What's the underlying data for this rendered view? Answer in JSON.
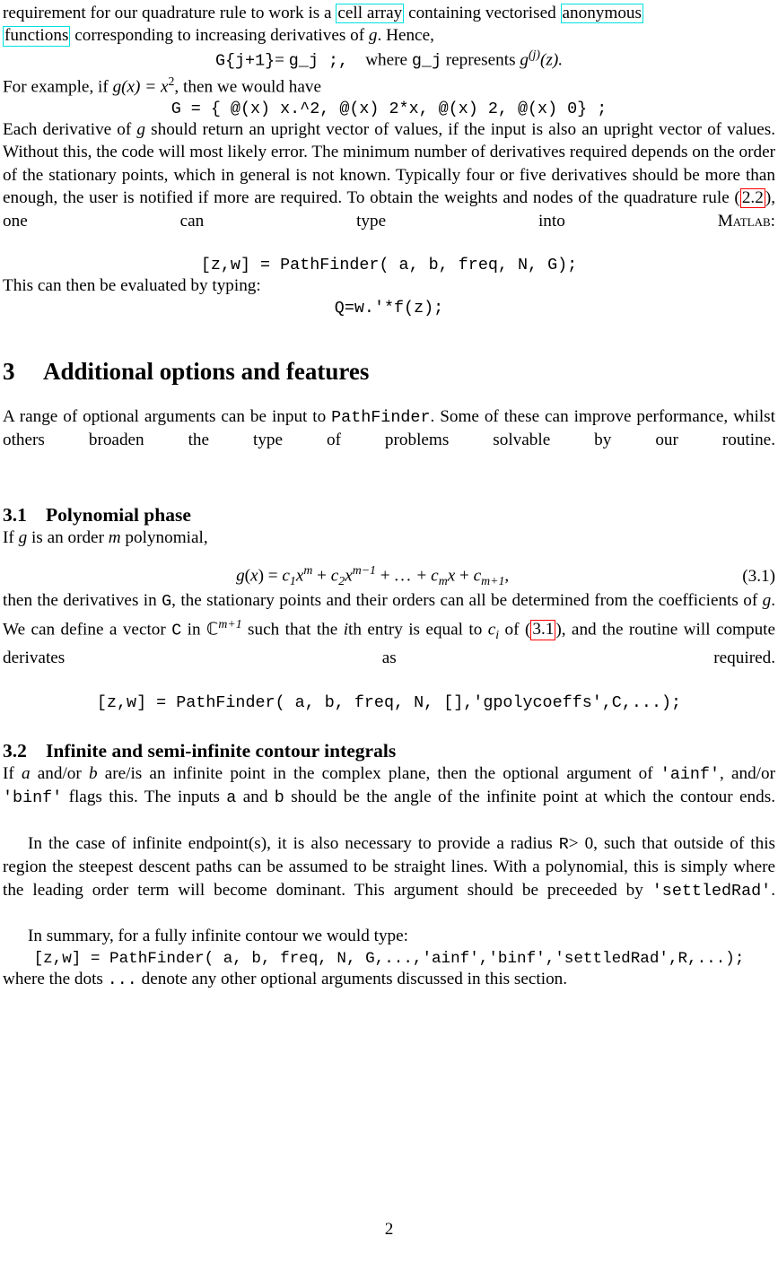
{
  "document": {
    "page_number": "2",
    "paragraphs": {
      "p1_a": "requirement for our quadrature rule to work is a ",
      "p1_link1": "cell array",
      "p1_b": " containing vectorised ",
      "p1_link2": "anonymous",
      "p1_link2b": "functions",
      "p1_c": " corresponding to increasing derivatives of ",
      "p1_g": "g",
      "p1_d": ". Hence,",
      "eq1_code1": "G{j+1}",
      "eq1_eq": "= ",
      "eq1_code2": "g_j",
      "eq1_semi": " ;,",
      "eq1_where": "where ",
      "eq1_code3": "g_j",
      "eq1_represents": " represents ",
      "eq1_gj": "g",
      "eq1_gj_sup": "(j)",
      "eq1_z": "(z).",
      "p2_a": "For example, if ",
      "p2_gx": "g(x) = x",
      "p2_sup": "2",
      "p2_b": ", then we would have",
      "eq2": "G = { @(x) x.^2, @(x) 2*x, @(x) 2, @(x) 0} ;",
      "p3_a": "Each derivative of ",
      "p3_g": "g",
      "p3_b": " should return an upright vector of values, if the input is also an upright vector of values. Without this, the code will most likely error. The minimum number of derivatives required depends on the order of the stationary points, which in general is not known. Typically four or five derivatives should be more than enough, the user is notified if more are required. To obtain the weights and nodes of the quadrature rule (",
      "p3_ref": "2.2",
      "p3_c": "), one can type into ",
      "p3_matlab": "Matlab",
      "p3_d": ":",
      "eq3": "[z,w] = PathFinder( a, b, freq, N, G);",
      "p4": "This can then be evaluated by typing:",
      "eq4": "Q=w.'*f(z);",
      "section3_num": "3",
      "section3_title": "Additional options and features",
      "p5_a": "A range of optional arguments can be input to ",
      "p5_code": "PathFinder",
      "p5_b": ". Some of these can improve performance, whilst others broaden the type of problems solvable by our routine.",
      "sub31_num": "3.1",
      "sub31_title": "Polynomial phase",
      "p6_a": "If ",
      "p6_g": "g",
      "p6_b": " is an order ",
      "p6_m": "m",
      "p6_c": " polynomial,",
      "eq31_body": "g(x) = c₁xᵐ + c₂xᵐ⁻¹ + … + cₘx + cₘ₊₁,",
      "eq31_tag": "(3.1)",
      "p7_a": "then the derivatives in ",
      "p7_codeG": "G",
      "p7_b": ", the stationary points and their orders can all be determined from the coefficients of ",
      "p7_g": "g",
      "p7_c": ". We can define a vector ",
      "p7_codeC": "C",
      "p7_d": " in ",
      "p7_field": "ℂ",
      "p7_field_sup": "m+1",
      "p7_e": " such that the ",
      "p7_i": "i",
      "p7_f": "th entry is equal to ",
      "p7_ci": "c",
      "p7_ci_sub": "i",
      "p7_h": " of (",
      "p7_ref": "3.1",
      "p7_j": "), and the routine will compute derivates as required.",
      "eq5": "[z,w] = PathFinder( a, b, freq, N, [],'gpolycoeffs',C,...);",
      "sub32_num": "3.2",
      "sub32_title": "Infinite and semi-infinite contour integrals",
      "p8_a": "If ",
      "p8_ai": "a",
      "p8_b": " and/or ",
      "p8_bi": "b",
      "p8_c": " are/is an infinite point in the complex plane, then the optional argument of ",
      "p8_ainf": "'ainf'",
      "p8_d": ", and/or ",
      "p8_binf": "'binf'",
      "p8_e": " flags this. The inputs ",
      "p8_code_a": "a",
      "p8_f": " and ",
      "p8_code_b": "b",
      "p8_g": " should be the angle of the infinite point at which the contour ends.",
      "p9_a": "In the case of infinite endpoint(s), it is also necessary to provide a radius ",
      "p9_R": "R",
      "p9_b": "> 0, such that outside of this region the steepest descent paths can be assumed to be straight lines. With a polynomial, this is simply where the leading order term will become dominant. This argument should be preceeded by ",
      "p9_settled": "'settledRad'",
      "p9_c": ".",
      "p10": "In summary, for a fully infinite contour we would type:",
      "eq6": "[z,w] = PathFinder( a, b, freq, N, G,...,'ainf','binf','settledRad',R,...);",
      "p11_a": "where the dots ",
      "p11_dots": "...",
      "p11_b": " denote any other optional arguments discussed in this section."
    },
    "colors": {
      "link_border_cyan": "#00e0e0",
      "link_border_red": "#ff0000",
      "text": "#000000",
      "background": "#ffffff"
    }
  }
}
